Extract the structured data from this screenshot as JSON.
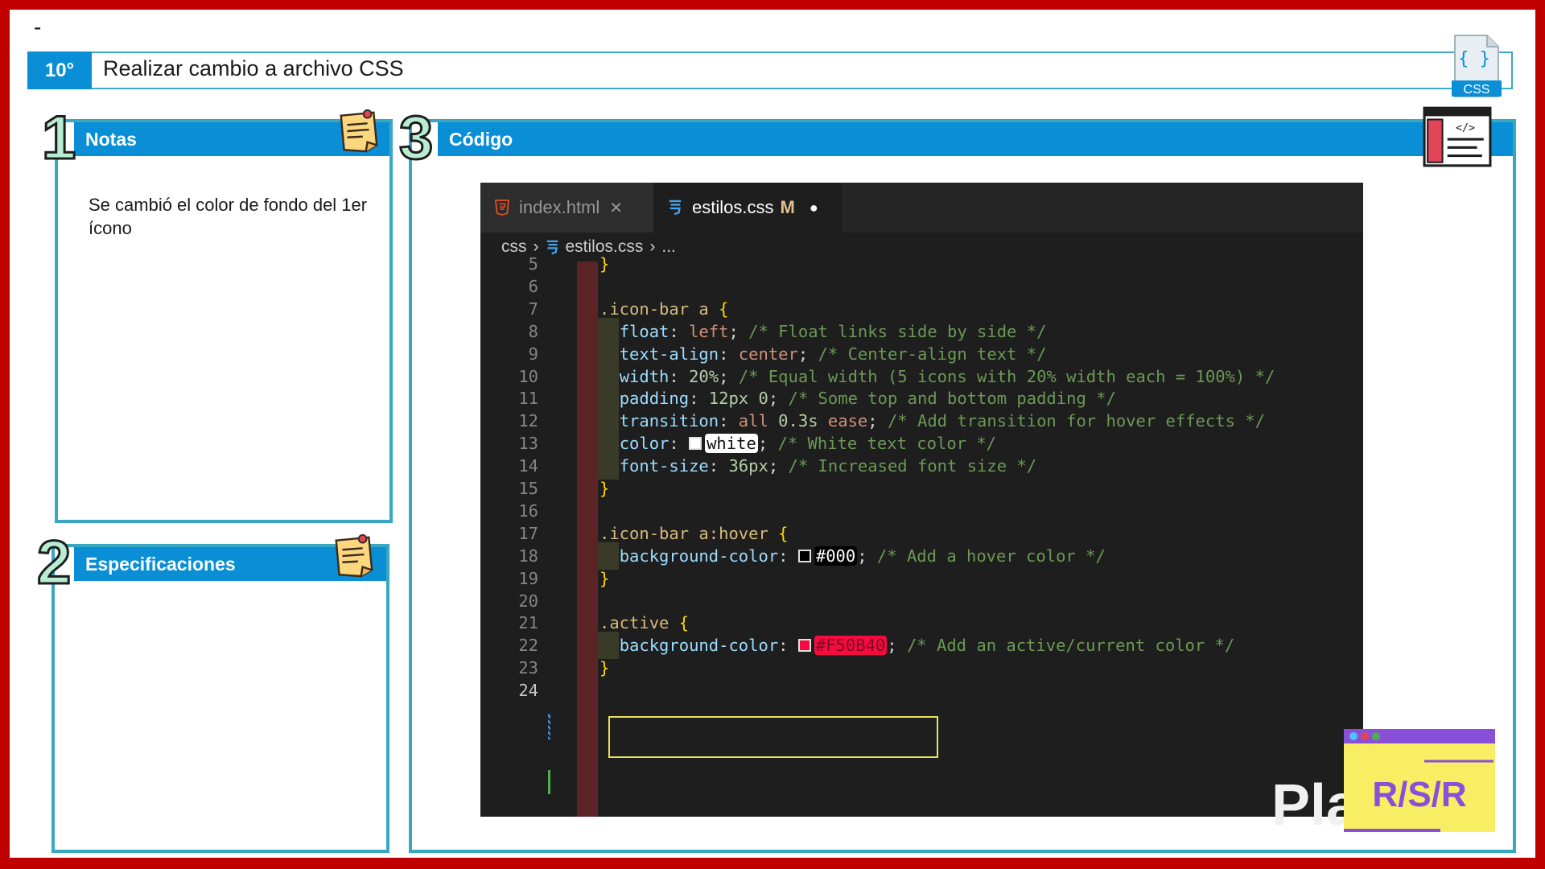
{
  "header": {
    "dash": "-",
    "step": "10°",
    "title": "Realizar cambio a archivo CSS",
    "css_badge": "CSS",
    "css_braces": "{ }"
  },
  "notas": {
    "number": "1",
    "title": "Notas",
    "text": "Se cambió el color de fondo del 1er ícono"
  },
  "especificaciones": {
    "number": "2",
    "title": "Especificaciones"
  },
  "codigo": {
    "number": "3",
    "title": "Código"
  },
  "editor": {
    "tabs": [
      {
        "label": "index.html",
        "close": "✕"
      },
      {
        "label": "estilos.css",
        "status": "M",
        "dot": "●"
      }
    ],
    "breadcrumb": [
      "css",
      "›",
      "estilos.css",
      "›",
      "..."
    ],
    "lines": [
      {
        "n": "5",
        "html": "<span class='brace'>}</span>"
      },
      {
        "n": "6",
        "html": ""
      },
      {
        "n": "7",
        "html": "<span class='sel'>.icon-bar a</span> <span class='brace'>{</span>"
      },
      {
        "n": "8",
        "indent": true,
        "html": "  <span class='prop'>float</span>: <span class='val'>left</span>; <span class='com'>/* Float links side by side */</span>"
      },
      {
        "n": "9",
        "indent": true,
        "html": "  <span class='prop'>text-align</span>: <span class='val'>center</span>; <span class='com'>/* Center-align text */</span>"
      },
      {
        "n": "10",
        "indent": true,
        "html": "  <span class='prop'>width</span>: <span class='num2'>20%</span>; <span class='com'>/* Equal width (5 icons with 20% width each = 100%) */</span>"
      },
      {
        "n": "11",
        "indent": true,
        "html": "  <span class='prop'>padding</span>: <span class='num2'>12px 0</span>; <span class='com'>/* Some top and bottom padding */</span>"
      },
      {
        "n": "12",
        "indent": true,
        "html": "  <span class='prop'>transition</span>: <span class='val'>all</span> <span class='num2'>0.3s</span> <span class='val'>ease</span>; <span class='com'>/* Add transition for hover effects */</span>"
      },
      {
        "n": "13",
        "indent": true,
        "html": "  <span class='prop'>color</span>: <span class='swatch' style='background:#ffffff'></span><span class='hl-white'>white</span>; <span class='com'>/* White text color */</span>"
      },
      {
        "n": "14",
        "indent": true,
        "html": "  <span class='prop'>font-size</span>: <span class='num2'>36px</span>; <span class='com'>/* Increased font size */</span>"
      },
      {
        "n": "15",
        "html": "<span class='brace'>}</span>"
      },
      {
        "n": "16",
        "html": ""
      },
      {
        "n": "17",
        "html": "<span class='sel'>.icon-bar a:hover</span> <span class='brace'>{</span>"
      },
      {
        "n": "18",
        "indent": true,
        "html": "  <span class='prop'>background-color</span>: <span class='swatch' style='background:#000000'></span><span class='hl-black'>#000</span>; <span class='com'>/* Add a hover color */</span>"
      },
      {
        "n": "19",
        "html": "<span class='brace'>}</span>"
      },
      {
        "n": "20",
        "html": ""
      },
      {
        "n": "21",
        "html": "<span class='sel'>.active</span> <span class='brace'>{</span>"
      },
      {
        "n": "22",
        "indent": true,
        "html": "  <span class='prop'>background-color</span>: <span class='swatch' style='background:#f50b40'></span><span class='hl-red'>#F50B40</span>; <span class='com'>/* Add an active/current color */</span>"
      },
      {
        "n": "23",
        "html": "<span class='brace'>}</span>"
      },
      {
        "n": "24",
        "html": ""
      }
    ]
  },
  "brand": {
    "watermark": "Platzi",
    "logo": "R/S/R"
  },
  "colors": {
    "frame": "#c00000",
    "accent": "#0a8fd6",
    "panel_border": "#37a7c2",
    "active_color": "#F50B40"
  }
}
